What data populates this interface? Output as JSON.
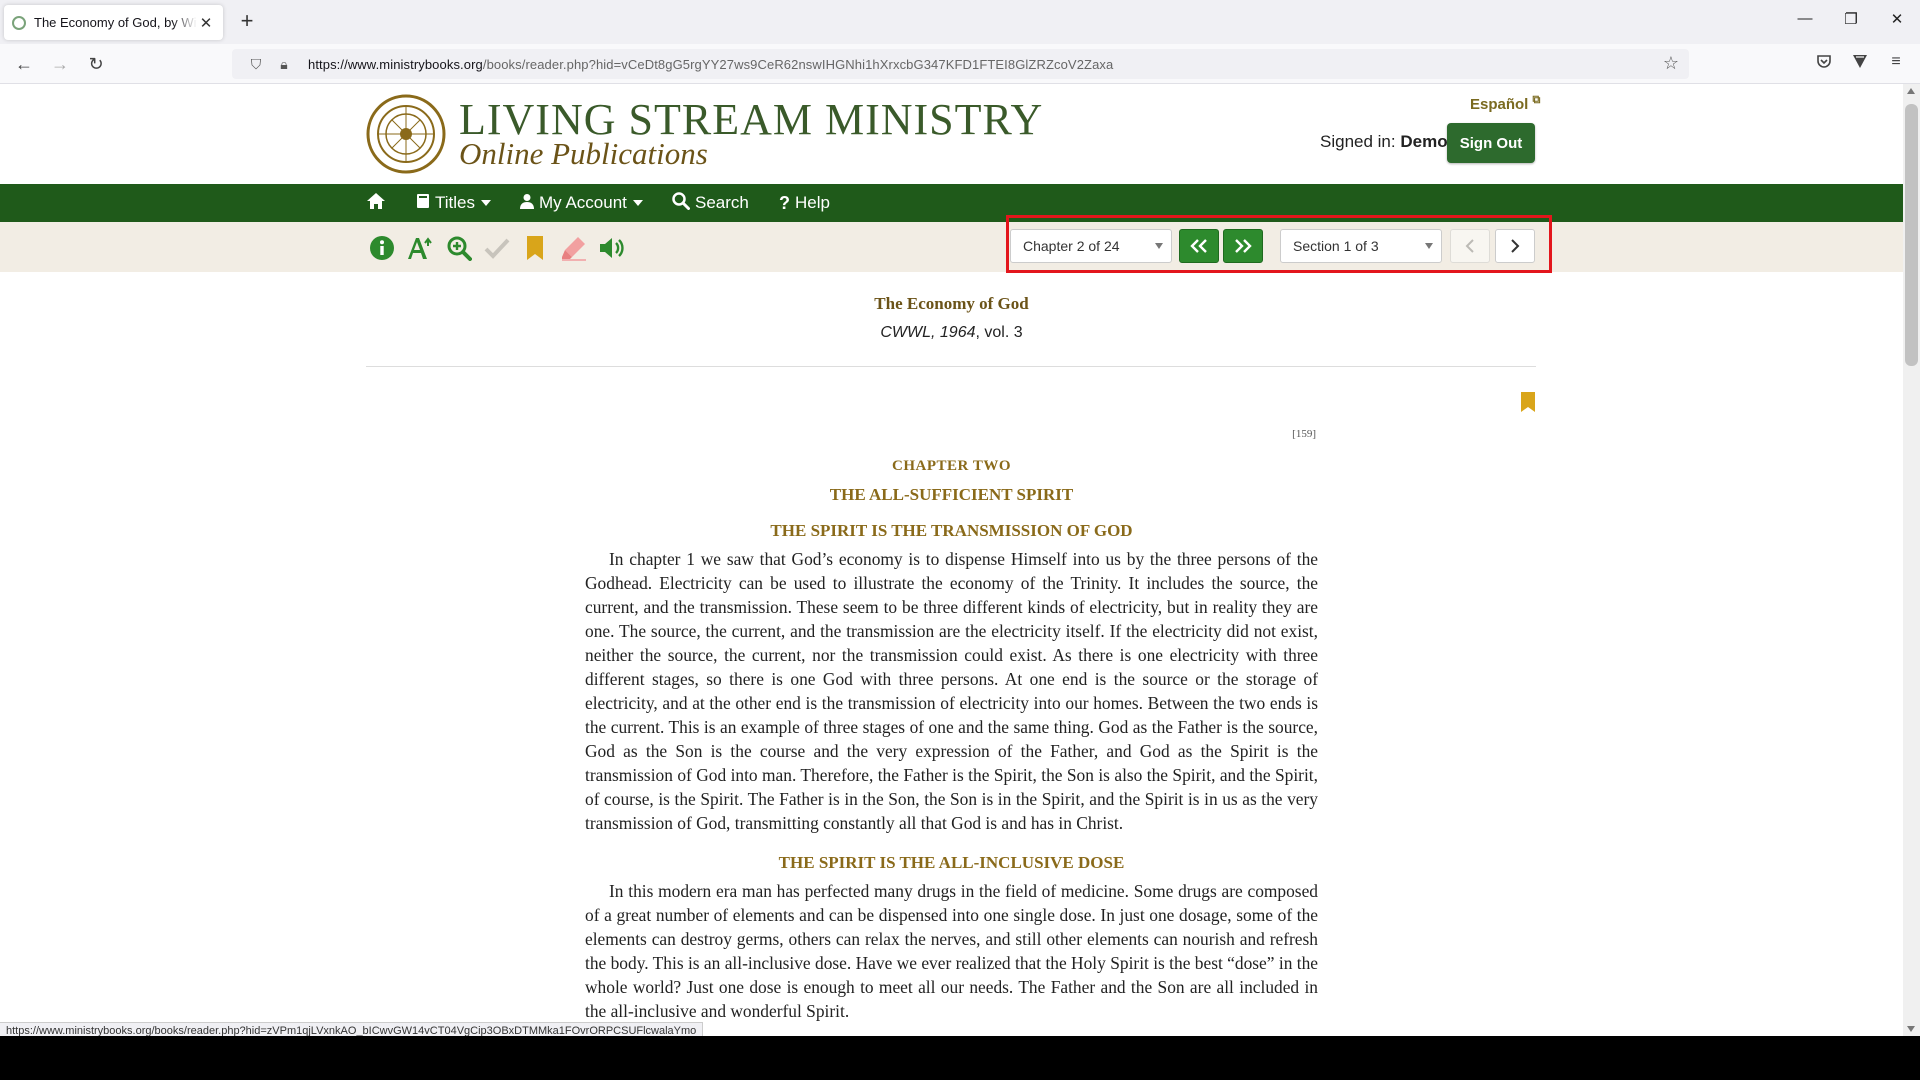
{
  "browser": {
    "tab_title": "The Economy of God, by Witness Lee",
    "url_host": "https://www.ministrybooks.org",
    "url_path": "/books/reader.php?hid=vCeDt8gG5rgYY27ws9CeR62nswIHGNhi1hXrxcbG347KFD1FTEI8GlZRZcoV2Zaxa",
    "status_url": "https://www.ministrybooks.org/books/reader.php?hid=zVPm1qjLVxnkAO_bICwvGW14vCT04VgCip3OBxDTMMka1FOvrORPCSUFlcwalaYmo"
  },
  "header": {
    "brand_title": "LIVING STREAM MINISTRY",
    "brand_subtitle": "Online Publications",
    "language_link": "Español",
    "signed_in_label": "Signed in:",
    "signed_in_user": "Demo",
    "sign_out_label": "Sign Out"
  },
  "menu": {
    "titles": "Titles",
    "my_account": "My Account",
    "search": "Search",
    "help": "Help"
  },
  "reader": {
    "chapter_select": "Chapter 2 of 24",
    "section_select": "Section 1 of 3"
  },
  "content": {
    "book_title": "The Economy of God",
    "book_sub_italic": "CWWL, 1964",
    "book_sub_rest": ", vol. 3",
    "page_number": "[159]",
    "chapter_label": "CHAPTER TWO",
    "chapter_title": "THE ALL-SUFFICIENT SPIRIT",
    "section1_heading": "THE SPIRIT IS THE TRANSMISSION OF GOD",
    "section1_para": "In chapter 1 we saw that God’s economy is to dispense Himself into us by the three persons of the Godhead. Electricity can be used to illustrate the economy of the Trinity. It includes the source, the current, and the transmission. These seem to be three different kinds of electricity, but in reality they are one. The source, the current, and the transmission are the electricity itself. If the electricity did not exist, neither the source, the current, nor the transmission could exist. As there is one electricity with three different stages, so there is one God with three persons. At one end is the source or the storage of electricity, and at the other end is the transmission of electricity into our homes. Between the two ends is the current. This is an example of three stages of one and the same thing. God as the Father is the source, God as the Son is the course and the very expression of the Father, and God as the Spirit is the transmission of God into man. Therefore, the Father is the Spirit, the Son is also the Spirit, and the Spirit, of course, is the Spirit. The Father is in the Son, the Son is in the Spirit, and the Spirit is in us as the very transmission of God, transmitting constantly all that God is and has in Christ.",
    "section2_heading": "THE SPIRIT IS THE ALL-INCLUSIVE DOSE",
    "section2_para": "In this modern era man has perfected many drugs in the field of medicine. Some drugs are composed of a great number of elements and can be dispensed into one single dose. In just one dosage, some of the elements can destroy germs, others can relax the nerves, and still other elements can nourish and refresh the body. This is an all-inclusive dose. Have we ever realized that the Holy Spirit is the best “dose” in the whole world? Just one dose is enough to meet all our needs. The Father and the Son are all included in the all-inclusive and wonderful Spirit."
  },
  "colors": {
    "menu_green": "#1f5a1a",
    "button_green": "#2d8a2d",
    "gold": "#8a6a1a",
    "highlight_red": "#e3161c"
  }
}
